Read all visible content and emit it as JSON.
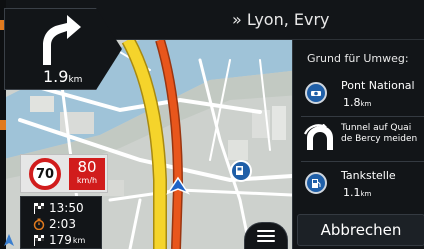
{
  "header": {
    "destination": "» Lyon, Evry"
  },
  "maneuver": {
    "distance_value": "1.9",
    "distance_unit": "km",
    "icon": "turn-left-arrow-icon"
  },
  "speed": {
    "limit": "70",
    "current": "80",
    "unit": "km/h"
  },
  "trip_info": {
    "arrival_time": "13:50",
    "remaining_time": "2:03",
    "remaining_distance_value": "179",
    "remaining_distance_unit": "km"
  },
  "detour": {
    "title": "Grund für Umweg:",
    "options": [
      {
        "label": "Pont National",
        "distance_value": "1.8",
        "distance_unit": "km",
        "icon": "bridge-icon"
      },
      {
        "label": "Tunnel auf Quai de Bercy meiden",
        "icon": "tunnel-avoid-icon"
      },
      {
        "label": "Tankstelle",
        "distance_value": "1.1",
        "distance_unit": "km",
        "icon": "fuel-station-icon"
      }
    ],
    "cancel_label": "Abbrechen"
  },
  "colors": {
    "panel_bg": "#121518",
    "route_orange": "#e8561c",
    "road_yellow": "#f5d42b",
    "speed_red": "#d11c1c",
    "poi_blue": "#1f5fa8"
  }
}
